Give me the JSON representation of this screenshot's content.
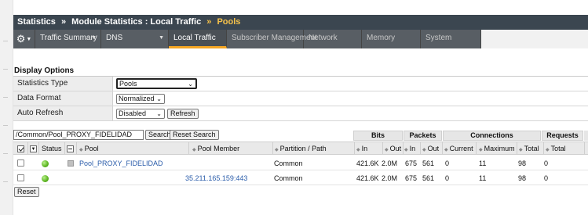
{
  "breadcrumb": {
    "root": "Statistics",
    "separator": "»",
    "module": "Module Statistics : Local Traffic",
    "current": "Pools"
  },
  "nav": {
    "tabs": [
      {
        "label": "Traffic Summary",
        "has_menu": true
      },
      {
        "label": "DNS",
        "has_menu": true
      },
      {
        "label": "Local Traffic",
        "active": true
      },
      {
        "label": "Subscriber Management"
      },
      {
        "label": "Network"
      },
      {
        "label": "Memory"
      },
      {
        "label": "System"
      }
    ]
  },
  "display_options": {
    "title": "Display Options",
    "statistics_type": {
      "label": "Statistics Type",
      "value": "Pools"
    },
    "data_format": {
      "label": "Data Format",
      "value": "Normalized"
    },
    "auto_refresh": {
      "label": "Auto Refresh",
      "value": "Disabled",
      "refresh_button": "Refresh"
    }
  },
  "search": {
    "value": "/Common/Pool_PROXY_FIDELIDAD",
    "search_button": "Search",
    "reset_button": "Reset Search"
  },
  "table": {
    "groups": {
      "bits": "Bits",
      "packets": "Packets",
      "connections": "Connections",
      "requests": "Requests"
    },
    "columns": {
      "status": "Status",
      "pool": "Pool",
      "pool_member": "Pool Member",
      "partition": "Partition / Path",
      "bits_in": "In",
      "bits_out": "Out",
      "packets_in": "In",
      "packets_out": "Out",
      "conn_current": "Current",
      "conn_maximum": "Maximum",
      "conn_total": "Total",
      "req_total": "Total"
    },
    "rows": [
      {
        "pool": "Pool_PROXY_FIDELIDAD",
        "member": "",
        "partition": "Common",
        "bits_in": "421.6K",
        "bits_out": "2.0M",
        "packets_in": "675",
        "packets_out": "561",
        "conn_current": "0",
        "conn_maximum": "11",
        "conn_total": "98",
        "req_total": "0"
      },
      {
        "pool": "",
        "member": "35.211.165.159:443",
        "partition": "Common",
        "bits_in": "421.6K",
        "bits_out": "2.0M",
        "packets_in": "675",
        "packets_out": "561",
        "conn_current": "0",
        "conn_maximum": "11",
        "conn_total": "98",
        "req_total": "0"
      }
    ]
  },
  "footer": {
    "reset_button": "Reset"
  },
  "colors": {
    "header_bg": "#3b4650",
    "nav_bg": "#585e64",
    "active_tab_accent": "#f5a623",
    "breadcrumb_current": "#f7c34b",
    "link": "#2a5caa",
    "status_green": "#5bb41f"
  },
  "icons": {
    "settings": "gear-icon",
    "status": "green-circle-icon",
    "pool_expand": "collapse-icon"
  }
}
